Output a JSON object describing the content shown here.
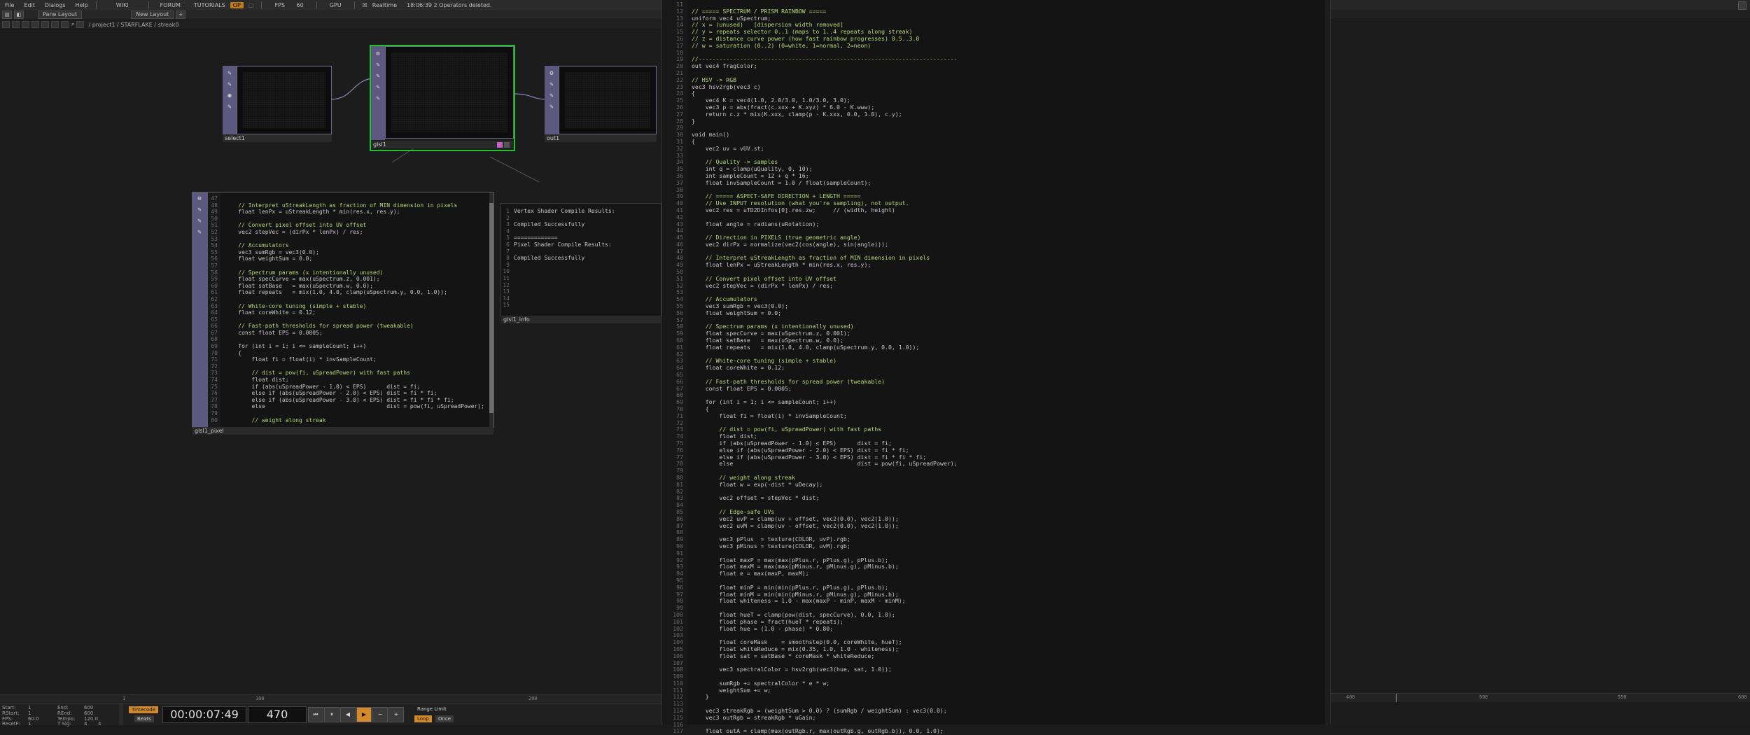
{
  "menu": {
    "items": [
      "File",
      "Edit",
      "Dialogs",
      "Help",
      "WIKI",
      "FORUM",
      "TUTORIALS"
    ],
    "perform_badge": "OP",
    "fps_label": "FPS",
    "fps_value": "60",
    "gpu": "GPU",
    "realtime": "Realtime",
    "status": "18:06:39 2 Operators deleted."
  },
  "toolbar": {
    "pane_layout": "Pane Layout",
    "new_layout": "New Layout",
    "plus": "+"
  },
  "path": "/ project1 / STARFLAKE / streak0",
  "operators": {
    "select1": "select1",
    "glsl1": "glsl1",
    "out1": "out1"
  },
  "pixel_dat": {
    "label": "glsl1_pixel",
    "lines": [
      [
        "47",
        ""
      ],
      [
        "48",
        "    // Interpret uStreakLength as fraction of MIN dimension in pixels"
      ],
      [
        "49",
        "    float lenPx = uStreakLength * min(res.x, res.y);"
      ],
      [
        "50",
        ""
      ],
      [
        "51",
        "    // Convert pixel offset into UV offset"
      ],
      [
        "52",
        "    vec2 stepVec = (dirPx * lenPx) / res;"
      ],
      [
        "53",
        ""
      ],
      [
        "54",
        "    // Accumulators"
      ],
      [
        "55",
        "    vec3 sumRgb = vec3(0.0);"
      ],
      [
        "56",
        "    float weightSum = 0.0;"
      ],
      [
        "57",
        ""
      ],
      [
        "58",
        "    // Spectrum params (x intentionally unused)"
      ],
      [
        "59",
        "    float specCurve = max(uSpectrum.z, 0.001);"
      ],
      [
        "60",
        "    float satBase   = max(uSpectrum.w, 0.0);"
      ],
      [
        "61",
        "    float repeats   = mix(1.0, 4.0, clamp(uSpectrum.y, 0.0, 1.0));"
      ],
      [
        "62",
        ""
      ],
      [
        "63",
        "    // White-core tuning (simple + stable)"
      ],
      [
        "64",
        "    float coreWhite = 0.12;"
      ],
      [
        "65",
        ""
      ],
      [
        "66",
        "    // Fast-path thresholds for spread power (tweakable)"
      ],
      [
        "67",
        "    const float EPS = 0.0005;"
      ],
      [
        "68",
        ""
      ],
      [
        "69",
        "    for (int i = 1; i <= sampleCount; i++)"
      ],
      [
        "70",
        "    {"
      ],
      [
        "71",
        "        float fi = float(i) * invSampleCount;"
      ],
      [
        "72",
        ""
      ],
      [
        "73",
        "        // dist = pow(fi, uSpreadPower) with fast paths"
      ],
      [
        "74",
        "        float dist;"
      ],
      [
        "75",
        "        if (abs(uSpreadPower - 1.0) < EPS)      dist = fi;"
      ],
      [
        "76",
        "        else if (abs(uSpreadPower - 2.0) < EPS) dist = fi * fi;"
      ],
      [
        "77",
        "        else if (abs(uSpreadPower - 3.0) < EPS) dist = fi * fi * fi;"
      ],
      [
        "78",
        "        else                                    dist = pow(fi, uSpreadPower);"
      ],
      [
        "79",
        ""
      ],
      [
        "80",
        "        // weight along streak"
      ]
    ]
  },
  "info_dat": {
    "label": "glsl1_info",
    "lines": [
      [
        "1",
        "Vertex Shader Compile Results:"
      ],
      [
        "2",
        ""
      ],
      [
        "3",
        "Compiled Successfully"
      ],
      [
        "4",
        ""
      ],
      [
        "5",
        "============="
      ],
      [
        "6",
        "Pixel Shader Compile Results:"
      ],
      [
        "7",
        ""
      ],
      [
        "8",
        "Compiled Successfully"
      ],
      [
        "9",
        ""
      ],
      [
        "10",
        ""
      ],
      [
        "11",
        ""
      ],
      [
        "12",
        ""
      ],
      [
        "13",
        ""
      ],
      [
        "14",
        ""
      ],
      [
        "15",
        ""
      ]
    ]
  },
  "code_panel": {
    "lines": [
      [
        "11",
        ""
      ],
      [
        "12",
        "// ===== SPECTRUM / PRISM RAINBOW ====="
      ],
      [
        "13",
        "uniform vec4 uSpectrum;"
      ],
      [
        "14",
        "// x = (unused)   [dispersion width removed]"
      ],
      [
        "15",
        "// y = repeats selector 0..1 (maps to 1..4 repeats along streak)"
      ],
      [
        "16",
        "// z = distance curve power (how fast rainbow progresses) 0.5..3.0"
      ],
      [
        "17",
        "// w = saturation (0..2) (0=white, 1=normal, 2=neon)"
      ],
      [
        "18",
        ""
      ],
      [
        "19",
        "//---------------------------------------------------------------------------"
      ],
      [
        "20",
        "out vec4 fragColor;"
      ],
      [
        "21",
        ""
      ],
      [
        "22",
        "// HSV -> RGB"
      ],
      [
        "23",
        "vec3 hsv2rgb(vec3 c)"
      ],
      [
        "24",
        "{"
      ],
      [
        "25",
        "    vec4 K = vec4(1.0, 2.0/3.0, 1.0/3.0, 3.0);"
      ],
      [
        "26",
        "    vec3 p = abs(fract(c.xxx + K.xyz) * 6.0 - K.www);"
      ],
      [
        "27",
        "    return c.z * mix(K.xxx, clamp(p - K.xxx, 0.0, 1.0), c.y);"
      ],
      [
        "28",
        "}"
      ],
      [
        "29",
        ""
      ],
      [
        "30",
        "void main()"
      ],
      [
        "31",
        "{"
      ],
      [
        "32",
        "    vec2 uv = vUV.st;"
      ],
      [
        "33",
        ""
      ],
      [
        "34",
        "    // Quality -> samples"
      ],
      [
        "35",
        "    int q = clamp(uQuality, 0, 10);"
      ],
      [
        "36",
        "    int sampleCount = 12 + q * 16;"
      ],
      [
        "37",
        "    float invSampleCount = 1.0 / float(sampleCount);"
      ],
      [
        "38",
        ""
      ],
      [
        "39",
        "    // ===== ASPECT-SAFE DIRECTION + LENGTH ====="
      ],
      [
        "40",
        "    // Use INPUT resolution (what you're sampling), not output."
      ],
      [
        "41",
        "    vec2 res = uTD2DInfos[0].res.zw;     // (width, height)"
      ],
      [
        "42",
        ""
      ],
      [
        "43",
        "    float angle = radians(uRotation);"
      ],
      [
        "44",
        ""
      ],
      [
        "45",
        "    // Direction in PIXELS (true geometric angle)"
      ],
      [
        "46",
        "    vec2 dirPx = normalize(vec2(cos(angle), sin(angle)));"
      ],
      [
        "47",
        ""
      ],
      [
        "48",
        "    // Interpret uStreakLength as fraction of MIN dimension in pixels"
      ],
      [
        "49",
        "    float lenPx = uStreakLength * min(res.x, res.y);"
      ],
      [
        "50",
        ""
      ],
      [
        "51",
        "    // Convert pixel offset into UV offset"
      ],
      [
        "52",
        "    vec2 stepVec = (dirPx * lenPx) / res;"
      ],
      [
        "53",
        ""
      ],
      [
        "54",
        "    // Accumulators"
      ],
      [
        "55",
        "    vec3 sumRgb = vec3(0.0);"
      ],
      [
        "56",
        "    float weightSum = 0.0;"
      ],
      [
        "57",
        ""
      ],
      [
        "58",
        "    // Spectrum params (x intentionally unused)"
      ],
      [
        "59",
        "    float specCurve = max(uSpectrum.z, 0.001);"
      ],
      [
        "60",
        "    float satBase   = max(uSpectrum.w, 0.0);"
      ],
      [
        "61",
        "    float repeats   = mix(1.0, 4.0, clamp(uSpectrum.y, 0.0, 1.0));"
      ],
      [
        "62",
        ""
      ],
      [
        "63",
        "    // White-core tuning (simple + stable)"
      ],
      [
        "64",
        "    float coreWhite = 0.12;"
      ],
      [
        "65",
        ""
      ],
      [
        "66",
        "    // Fast-path thresholds for spread power (tweakable)"
      ],
      [
        "67",
        "    const float EPS = 0.0005;"
      ],
      [
        "68",
        ""
      ],
      [
        "69",
        "    for (int i = 1; i <= sampleCount; i++)"
      ],
      [
        "70",
        "    {"
      ],
      [
        "71",
        "        float fi = float(i) * invSampleCount;"
      ],
      [
        "72",
        ""
      ],
      [
        "73",
        "        // dist = pow(fi, uSpreadPower) with fast paths"
      ],
      [
        "74",
        "        float dist;"
      ],
      [
        "75",
        "        if (abs(uSpreadPower - 1.0) < EPS)      dist = fi;"
      ],
      [
        "76",
        "        else if (abs(uSpreadPower - 2.0) < EPS) dist = fi * fi;"
      ],
      [
        "77",
        "        else if (abs(uSpreadPower - 3.0) < EPS) dist = fi * fi * fi;"
      ],
      [
        "78",
        "        else                                    dist = pow(fi, uSpreadPower);"
      ],
      [
        "79",
        ""
      ],
      [
        "80",
        "        // weight along streak"
      ],
      [
        "81",
        "        float w = exp(-dist * uDecay);"
      ],
      [
        "82",
        ""
      ],
      [
        "83",
        "        vec2 offset = stepVec * dist;"
      ],
      [
        "84",
        ""
      ],
      [
        "85",
        "        // Edge-safe UVs"
      ],
      [
        "86",
        "        vec2 uvP = clamp(uv + offset, vec2(0.0), vec2(1.0));"
      ],
      [
        "87",
        "        vec2 uvM = clamp(uv - offset, vec2(0.0), vec2(1.0));"
      ],
      [
        "88",
        ""
      ],
      [
        "89",
        "        vec3 pPlus  = texture(COLOR, uvP).rgb;"
      ],
      [
        "90",
        "        vec3 pMinus = texture(COLOR, uvM).rgb;"
      ],
      [
        "91",
        ""
      ],
      [
        "92",
        "        float maxP = max(max(pPlus.r, pPlus.g), pPlus.b);"
      ],
      [
        "93",
        "        float maxM = max(max(pMinus.r, pMinus.g), pMinus.b);"
      ],
      [
        "94",
        "        float e = max(maxP, maxM);"
      ],
      [
        "95",
        ""
      ],
      [
        "96",
        "        float minP = min(min(pPlus.r, pPlus.g), pPlus.b);"
      ],
      [
        "97",
        "        float minM = min(min(pMinus.r, pMinus.g), pMinus.b);"
      ],
      [
        "98",
        "        float whiteness = 1.0 - max(maxP - minP, maxM - minM);"
      ],
      [
        "99",
        ""
      ],
      [
        "100",
        "        float hueT = clamp(pow(dist, specCurve), 0.0, 1.0);"
      ],
      [
        "101",
        "        float phase = fract(hueT * repeats);"
      ],
      [
        "102",
        "        float hue = (1.0 - phase) * 0.80;"
      ],
      [
        "103",
        ""
      ],
      [
        "104",
        "        float coreMask    = smoothstep(0.0, coreWhite, hueT);"
      ],
      [
        "105",
        "        float whiteReduce = mix(0.35, 1.0, 1.0 - whiteness);"
      ],
      [
        "106",
        "        float sat = satBase * coreMask * whiteReduce;"
      ],
      [
        "107",
        ""
      ],
      [
        "108",
        "        vec3 spectralColor = hsv2rgb(vec3(hue, sat, 1.0));"
      ],
      [
        "109",
        ""
      ],
      [
        "110",
        "        sumRgb += spectralColor * e * w;"
      ],
      [
        "111",
        "        weightSum += w;"
      ],
      [
        "112",
        "    }"
      ],
      [
        "113",
        ""
      ],
      [
        "114",
        "    vec3 streakRgb = (weightSum > 0.0) ? (sumRgb / weightSum) : vec3(0.0);"
      ],
      [
        "115",
        "    vec3 outRgb = streakRgb * uGain;"
      ],
      [
        "116",
        ""
      ],
      [
        "117",
        "    float outA = clamp(max(outRgb.r, max(outRgb.g, outRgb.b)), 0.0, 1.0);"
      ]
    ]
  },
  "timeline": {
    "ticks": [
      "1",
      "100",
      "200"
    ],
    "right_ticks": [
      "400",
      "500",
      "550",
      "600"
    ],
    "stats": {
      "start_label": "Start:",
      "start": "1",
      "end_label": "End:",
      "end": "600",
      "rstart_label": "RStart:",
      "rstart": "1",
      "rend_label": "REnd:",
      "rend": "600",
      "fps_label": "FPS:",
      "fps": "60.0",
      "tempo_label": "Tempo:",
      "tempo": "120.0",
      "resetf_label": "ResetF:",
      "resetf": "1",
      "tsig_label": "T Sig:",
      "tsig_a": "4",
      "tsig_b": "4"
    },
    "timecode": "Timecode",
    "beats": "Beats",
    "time": "00:00:07:49",
    "frame": "470",
    "range_limit": "Range Limit",
    "loop": "Loop",
    "once": "Once"
  },
  "colors": {
    "selected_border": "#25c02a",
    "op_side": "#5d5880",
    "accent": "#d48a2a",
    "comment": "#b8d97a"
  }
}
